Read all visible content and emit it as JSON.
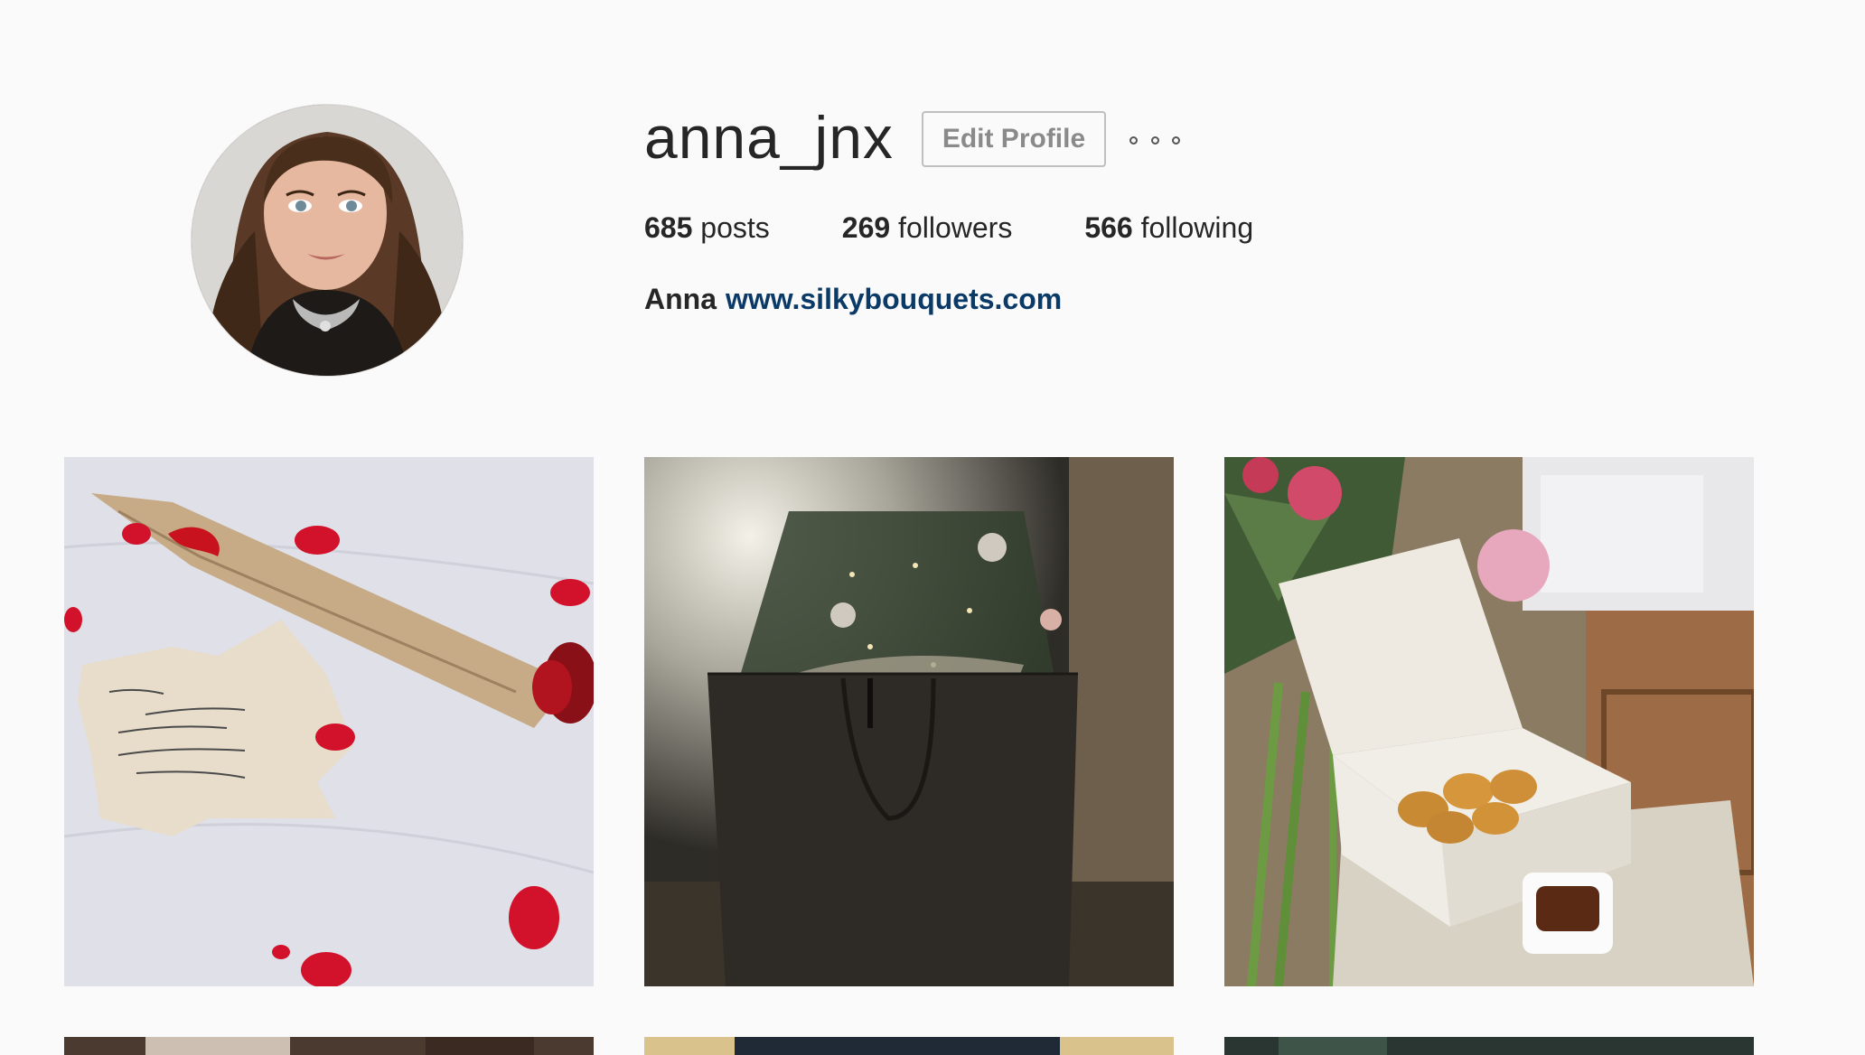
{
  "profile": {
    "username": "anna_jnx",
    "edit_label": "Edit Profile",
    "full_name": "Anna",
    "website": "www.silkybouquets.com"
  },
  "stats": [
    {
      "count": "685",
      "label": "posts"
    },
    {
      "count": "269",
      "label": "followers"
    },
    {
      "count": "566",
      "label": "following"
    }
  ],
  "icons": {
    "more": "more-options-icon"
  }
}
